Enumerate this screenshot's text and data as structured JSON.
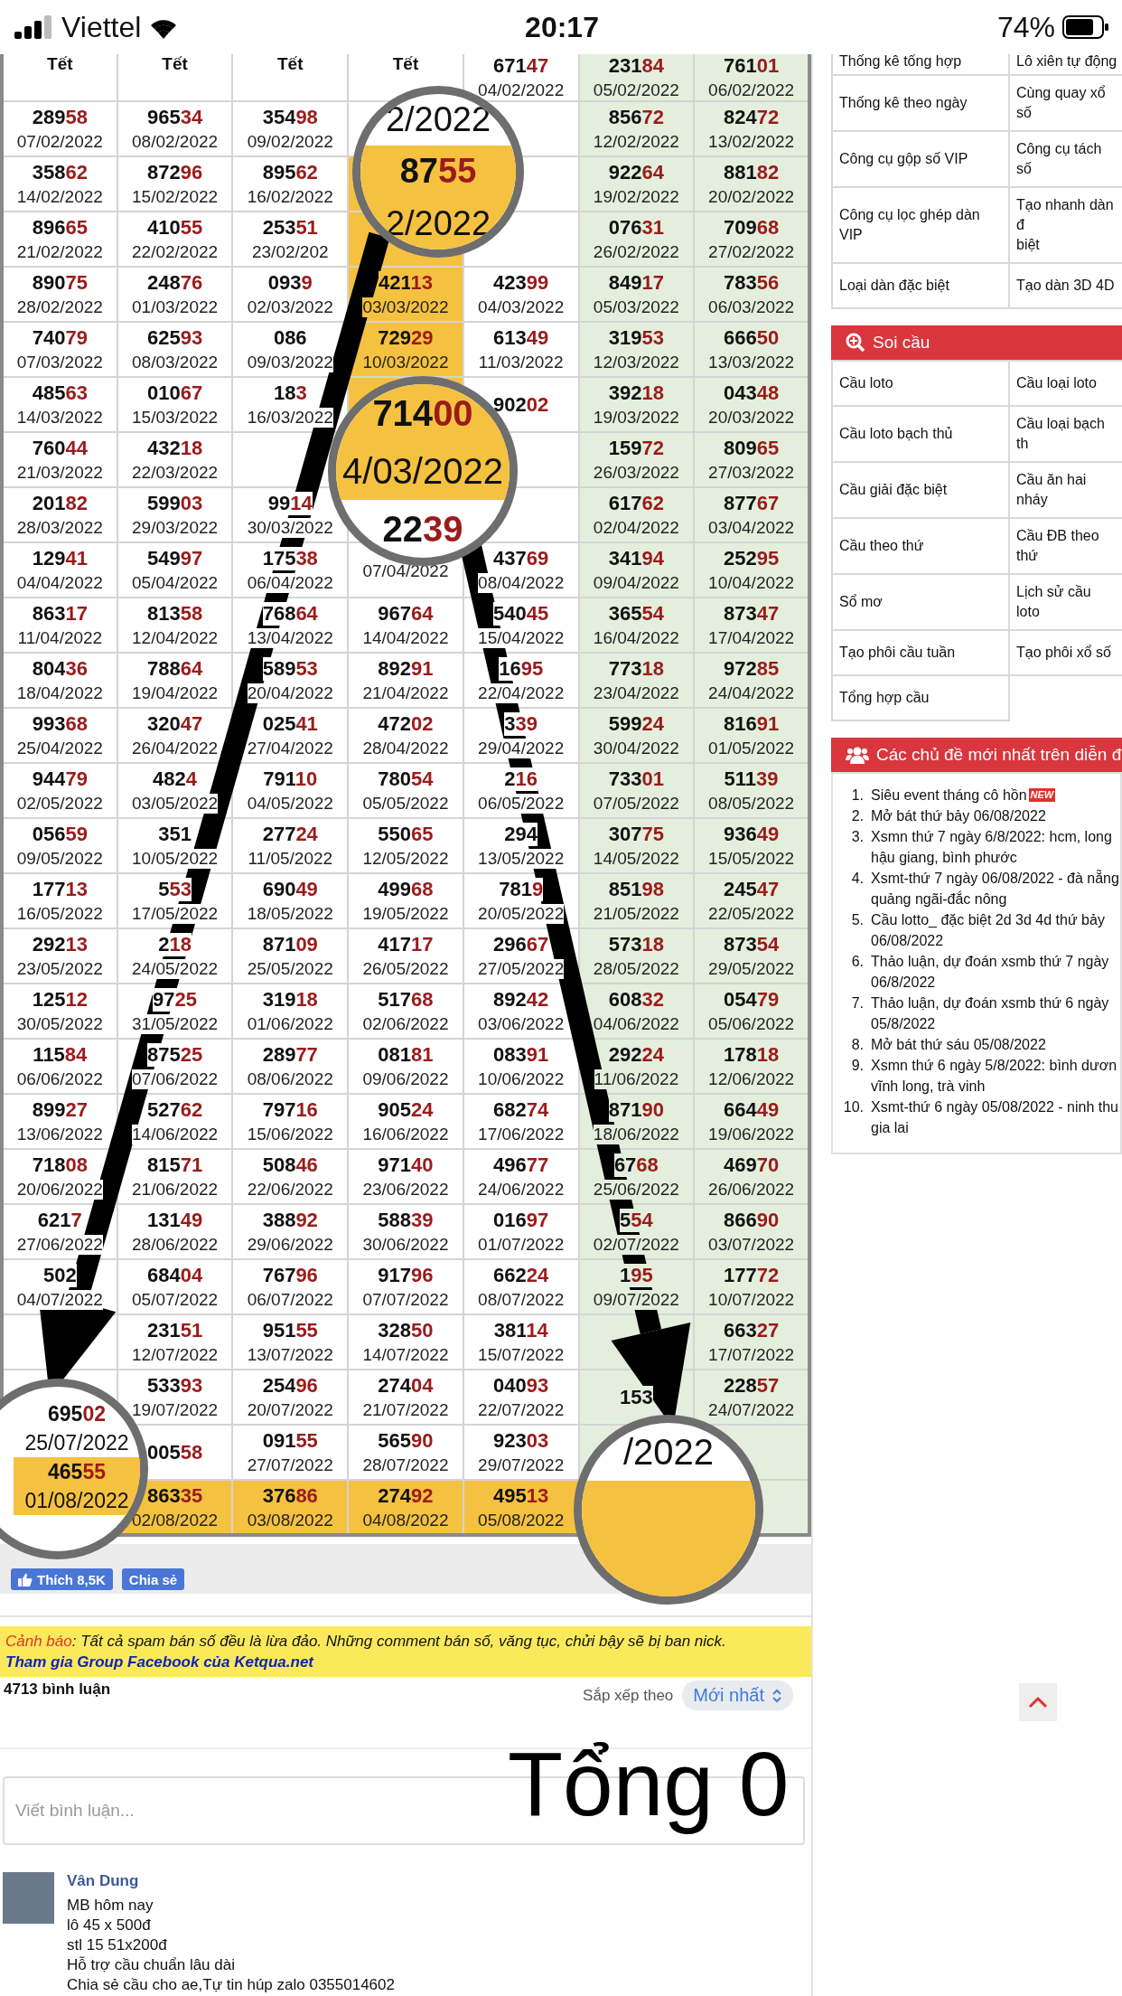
{
  "status_bar": {
    "carrier": "Viettel",
    "time": "20:17",
    "battery": "74%"
  },
  "weekend_columns": [
    false,
    false,
    false,
    false,
    false,
    true,
    true
  ],
  "rows": [
    [
      {
        "label": "Tết",
        "highlighted": false
      },
      {
        "label": "Tết",
        "highlighted": false
      },
      {
        "label": "Tết",
        "highlighted": false
      },
      {
        "label": "Tết",
        "highlighted": false
      },
      {
        "num": "671",
        "end": "47",
        "date": "04/02/2022",
        "highlighted": false
      },
      {
        "num": "231",
        "end": "84",
        "date": "05/02/2022",
        "highlighted": false
      },
      {
        "num": "761",
        "end": "01",
        "date": "06/02/2022",
        "highlighted": false
      }
    ],
    [
      {
        "num": "289",
        "end": "58",
        "date": "07/02/2022",
        "highlighted": false
      },
      {
        "num": "965",
        "end": "34",
        "date": "08/02/2022",
        "highlighted": false
      },
      {
        "num": "354",
        "end": "98",
        "date": "09/02/2022",
        "highlighted": false
      },
      {
        "highlighted": false
      },
      {
        "highlighted": false
      },
      {
        "num": "856",
        "end": "72",
        "date": "12/02/2022",
        "highlighted": false
      },
      {
        "num": "824",
        "end": "72",
        "date": "13/02/2022",
        "highlighted": false
      }
    ],
    [
      {
        "num": "358",
        "end": "62",
        "date": "14/02/2022",
        "highlighted": false
      },
      {
        "num": "872",
        "end": "96",
        "date": "15/02/2022",
        "highlighted": false
      },
      {
        "num": "895",
        "end": "62",
        "date": "16/02/2022",
        "highlighted": false
      },
      {
        "highlighted": true
      },
      {
        "highlighted": false
      },
      {
        "num": "922",
        "end": "64",
        "date": "19/02/2022",
        "highlighted": false
      },
      {
        "num": "881",
        "end": "82",
        "date": "20/02/2022",
        "highlighted": false
      }
    ],
    [
      {
        "num": "896",
        "end": "65",
        "date": "21/02/2022",
        "highlighted": false
      },
      {
        "num": "410",
        "end": "55",
        "date": "22/02/2022",
        "highlighted": false
      },
      {
        "num": "253",
        "end": "51",
        "date": "23/02/202",
        "highlighted": false
      },
      {
        "highlighted": true
      },
      {
        "highlighted": false
      },
      {
        "num": "076",
        "end": "31",
        "date": "26/02/2022",
        "highlighted": false
      },
      {
        "num": "709",
        "end": "68",
        "date": "27/02/2022",
        "highlighted": false
      }
    ],
    [
      {
        "num": "890",
        "end": "75",
        "date": "28/02/2022",
        "highlighted": false
      },
      {
        "num": "248",
        "end": "76",
        "date": "01/03/2022",
        "highlighted": false
      },
      {
        "num": "093",
        "end": "9",
        "date": "02/03/2022",
        "highlighted": false
      },
      {
        "num": "421",
        "end": "13",
        "date": "03/03/2022",
        "highlighted": true
      },
      {
        "num": "423",
        "end": "99",
        "date": "04/03/2022",
        "highlighted": false
      },
      {
        "num": "849",
        "end": "17",
        "date": "05/03/2022",
        "highlighted": false
      },
      {
        "num": "783",
        "end": "56",
        "date": "06/03/2022",
        "highlighted": false
      }
    ],
    [
      {
        "num": "740",
        "end": "79",
        "date": "07/03/2022",
        "highlighted": false
      },
      {
        "num": "625",
        "end": "93",
        "date": "08/03/2022",
        "highlighted": false
      },
      {
        "num": "086",
        "date": "09/03/2022",
        "highlighted": false
      },
      {
        "num": "729",
        "end": "29",
        "date": "10/03/2022",
        "highlighted": true
      },
      {
        "num": "613",
        "end": "49",
        "date": "11/03/2022",
        "highlighted": false
      },
      {
        "num": "319",
        "end": "53",
        "date": "12/03/2022",
        "highlighted": false
      },
      {
        "num": "666",
        "end": "50",
        "date": "13/03/2022",
        "highlighted": false
      }
    ],
    [
      {
        "num": "485",
        "end": "63",
        "date": "14/03/2022",
        "highlighted": false
      },
      {
        "num": "010",
        "end": "67",
        "date": "15/03/2022",
        "highlighted": false
      },
      {
        "num": "18",
        "end": "3",
        "date": "16/03/2022",
        "highlighted": false
      },
      {
        "highlighted": true
      },
      {
        "num": "902",
        "end": "02",
        "highlighted": false
      },
      {
        "num": "392",
        "end": "18",
        "date": "19/03/2022",
        "highlighted": false
      },
      {
        "num": "043",
        "end": "48",
        "date": "20/03/2022",
        "highlighted": false
      }
    ],
    [
      {
        "num": "760",
        "end": "44",
        "date": "21/03/2022",
        "highlighted": false
      },
      {
        "num": "432",
        "end": "18",
        "date": "22/03/2022",
        "highlighted": false
      },
      {
        "highlighted": false
      },
      {},
      {
        "highlighted": false
      },
      {
        "num": "159",
        "end": "72",
        "date": "26/03/2022",
        "highlighted": false
      },
      {
        "num": "809",
        "end": "65",
        "date": "27/03/2022",
        "highlighted": false
      }
    ],
    [
      {
        "num": "201",
        "end": "82",
        "date": "28/03/2022",
        "highlighted": false
      },
      {
        "num": "599",
        "end": "03",
        "date": "29/03/2022",
        "highlighted": false
      },
      {
        "num": "99",
        "end": "14",
        "date": "30/03/2022",
        "highlighted": false
      },
      {
        "highlighted": false
      },
      {
        "highlighted": false
      },
      {
        "num": "617",
        "end": "62",
        "date": "02/04/2022",
        "highlighted": false
      },
      {
        "num": "877",
        "end": "67",
        "date": "03/04/2022",
        "highlighted": false
      }
    ],
    [
      {
        "num": "129",
        "end": "41",
        "date": "04/04/2022",
        "highlighted": false
      },
      {
        "num": "549",
        "end": "97",
        "date": "05/04/2022",
        "highlighted": false
      },
      {
        "num": "175",
        "end": "38",
        "date": "06/04/2022",
        "highlighted": false
      },
      {
        "date": "07/04/2022",
        "highlighted": false
      },
      {
        "num": "437",
        "end": "69",
        "date": "08/04/2022",
        "highlighted": false
      },
      {
        "num": "341",
        "end": "94",
        "date": "09/04/2022",
        "highlighted": false
      },
      {
        "num": "252",
        "end": "95",
        "date": "10/04/2022",
        "highlighted": false
      }
    ],
    [
      {
        "num": "863",
        "end": "17",
        "date": "11/04/2022",
        "highlighted": false
      },
      {
        "num": "813",
        "end": "58",
        "date": "12/04/2022",
        "highlighted": false
      },
      {
        "num": "768",
        "end": "64",
        "date": "13/04/2022",
        "highlighted": false
      },
      {
        "num": "967",
        "end": "64",
        "date": "14/04/2022",
        "highlighted": false
      },
      {
        "num": "540",
        "end": "45",
        "date": "15/04/2022",
        "highlighted": false
      },
      {
        "num": "365",
        "end": "54",
        "date": "16/04/2022",
        "highlighted": false
      },
      {
        "num": "873",
        "end": "47",
        "date": "17/04/2022",
        "highlighted": false
      }
    ],
    [
      {
        "num": "804",
        "end": "36",
        "date": "18/04/2022",
        "highlighted": false
      },
      {
        "num": "788",
        "end": "64",
        "date": "19/04/2022",
        "highlighted": false
      },
      {
        "num": "589",
        "end": "53",
        "date": "20/04/2022",
        "highlighted": false
      },
      {
        "num": "892",
        "end": "91",
        "date": "21/04/2022",
        "highlighted": false
      },
      {
        "num": "16",
        "end": "95",
        "date": "22/04/2022",
        "highlighted": false
      },
      {
        "num": "773",
        "end": "18",
        "date": "23/04/2022",
        "highlighted": false
      },
      {
        "num": "972",
        "end": "85",
        "date": "24/04/2022",
        "highlighted": false
      }
    ],
    [
      {
        "num": "993",
        "end": "68",
        "date": "25/04/2022",
        "highlighted": false
      },
      {
        "num": "320",
        "end": "47",
        "date": "26/04/2022",
        "highlighted": false
      },
      {
        "num": "025",
        "end": "41",
        "date": "27/04/2022",
        "highlighted": false
      },
      {
        "num": "472",
        "end": "02",
        "date": "28/04/2022",
        "highlighted": false
      },
      {
        "num": "3",
        "end": "39",
        "date": "29/04/2022",
        "highlighted": false
      },
      {
        "num": "599",
        "end": "24",
        "date": "30/04/2022",
        "highlighted": false
      },
      {
        "num": "816",
        "end": "91",
        "date": "01/05/2022",
        "highlighted": false
      }
    ],
    [
      {
        "num": "944",
        "end": "79",
        "date": "02/05/2022",
        "highlighted": false
      },
      {
        "num": "482",
        "end": "4",
        "date": "03/05/2022",
        "highlighted": false
      },
      {
        "num": "791",
        "end": "10",
        "date": "04/05/2022",
        "highlighted": false
      },
      {
        "num": "780",
        "end": "54",
        "date": "05/05/2022",
        "highlighted": false
      },
      {
        "num": "2",
        "end": "16",
        "date": "06/05/2022",
        "highlighted": false
      },
      {
        "num": "733",
        "end": "01",
        "date": "07/05/2022",
        "highlighted": false
      },
      {
        "num": "511",
        "end": "39",
        "date": "08/05/2022",
        "highlighted": false
      }
    ],
    [
      {
        "num": "056",
        "end": "59",
        "date": "09/05/2022",
        "highlighted": false
      },
      {
        "num": "351",
        "date": "10/05/2022",
        "highlighted": false
      },
      {
        "num": "277",
        "end": "24",
        "date": "11/05/2022",
        "highlighted": false
      },
      {
        "num": "550",
        "end": "65",
        "date": "12/05/2022",
        "highlighted": false
      },
      {
        "num": "294",
        "date": "13/05/2022",
        "highlighted": false
      },
      {
        "num": "307",
        "end": "75",
        "date": "14/05/2022",
        "highlighted": false
      },
      {
        "num": "936",
        "end": "49",
        "date": "15/05/2022",
        "highlighted": false
      }
    ],
    [
      {
        "num": "177",
        "end": "13",
        "date": "16/05/2022",
        "highlighted": false
      },
      {
        "num": "5",
        "end": "53",
        "date": "17/05/2022",
        "highlighted": false
      },
      {
        "num": "690",
        "end": "49",
        "date": "18/05/2022",
        "highlighted": false
      },
      {
        "num": "499",
        "end": "68",
        "date": "19/05/2022",
        "highlighted": false
      },
      {
        "num": "781",
        "end": "9",
        "date": "20/05/2022",
        "highlighted": false
      },
      {
        "num": "851",
        "end": "98",
        "date": "21/05/2022",
        "highlighted": false
      },
      {
        "num": "245",
        "end": "47",
        "date": "22/05/2022",
        "highlighted": false
      }
    ],
    [
      {
        "num": "292",
        "end": "13",
        "date": "23/05/2022",
        "highlighted": false
      },
      {
        "num": "2",
        "end": "18",
        "date": "24/05/2022",
        "highlighted": false
      },
      {
        "num": "871",
        "end": "09",
        "date": "25/05/2022",
        "highlighted": false
      },
      {
        "num": "417",
        "end": "17",
        "date": "26/05/2022",
        "highlighted": false
      },
      {
        "num": "296",
        "end": "67",
        "date": "27/05/2022",
        "highlighted": false
      },
      {
        "num": "573",
        "end": "18",
        "date": "28/05/2022",
        "highlighted": false
      },
      {
        "num": "873",
        "end": "54",
        "date": "29/05/2022",
        "highlighted": false
      }
    ],
    [
      {
        "num": "125",
        "end": "12",
        "date": "30/05/2022",
        "highlighted": false
      },
      {
        "num": "97",
        "end": "25",
        "date": "31/05/2022",
        "highlighted": false
      },
      {
        "num": "319",
        "end": "18",
        "date": "01/06/2022",
        "highlighted": false
      },
      {
        "num": "517",
        "end": "68",
        "date": "02/06/2022",
        "highlighted": false
      },
      {
        "num": "892",
        "end": "42",
        "date": "03/06/2022",
        "highlighted": false
      },
      {
        "num": "608",
        "end": "32",
        "date": "04/06/2022",
        "highlighted": false
      },
      {
        "num": "054",
        "end": "79",
        "date": "05/06/2022",
        "highlighted": false
      }
    ],
    [
      {
        "num": "115",
        "end": "84",
        "date": "06/06/2022",
        "highlighted": false
      },
      {
        "num": "875",
        "end": "25",
        "date": "07/06/2022",
        "highlighted": false
      },
      {
        "num": "289",
        "end": "77",
        "date": "08/06/2022",
        "highlighted": false
      },
      {
        "num": "081",
        "end": "81",
        "date": "09/06/2022",
        "highlighted": false
      },
      {
        "num": "083",
        "end": "91",
        "date": "10/06/2022",
        "highlighted": false
      },
      {
        "num": "292",
        "end": "24",
        "date": "11/06/2022",
        "highlighted": false
      },
      {
        "num": "178",
        "end": "18",
        "date": "12/06/2022",
        "highlighted": false
      }
    ],
    [
      {
        "num": "899",
        "end": "27",
        "date": "13/06/2022",
        "highlighted": false
      },
      {
        "num": "527",
        "end": "62",
        "date": "14/06/2022",
        "highlighted": false
      },
      {
        "num": "797",
        "end": "16",
        "date": "15/06/2022",
        "highlighted": false
      },
      {
        "num": "905",
        "end": "24",
        "date": "16/06/2022",
        "highlighted": false
      },
      {
        "num": "682",
        "end": "74",
        "date": "17/06/2022",
        "highlighted": false
      },
      {
        "num": "871",
        "end": "90",
        "date": "18/06/2022",
        "highlighted": false
      },
      {
        "num": "664",
        "end": "49",
        "date": "19/06/2022",
        "highlighted": false
      }
    ],
    [
      {
        "num": "718",
        "end": "08",
        "date": "20/06/2022",
        "highlighted": false
      },
      {
        "num": "815",
        "end": "71",
        "date": "21/06/2022",
        "highlighted": false
      },
      {
        "num": "508",
        "end": "46",
        "date": "22/06/2022",
        "highlighted": false
      },
      {
        "num": "971",
        "end": "40",
        "date": "23/06/2022",
        "highlighted": false
      },
      {
        "num": "496",
        "end": "77",
        "date": "24/06/2022",
        "highlighted": false
      },
      {
        "num": "67",
        "end": "68",
        "date": "25/06/2022",
        "highlighted": false
      },
      {
        "num": "469",
        "end": "70",
        "date": "26/06/2022",
        "highlighted": false
      }
    ],
    [
      {
        "num": "621",
        "end": "7",
        "date": "27/06/2022",
        "highlighted": false
      },
      {
        "num": "131",
        "end": "49",
        "date": "28/06/2022",
        "highlighted": false
      },
      {
        "num": "388",
        "end": "92",
        "date": "29/06/2022",
        "highlighted": false
      },
      {
        "num": "588",
        "end": "39",
        "date": "30/06/2022",
        "highlighted": false
      },
      {
        "num": "016",
        "end": "97",
        "date": "01/07/2022",
        "highlighted": false
      },
      {
        "num": "5",
        "end": "54",
        "date": "02/07/2022",
        "highlighted": false
      },
      {
        "num": "866",
        "end": "90",
        "date": "03/07/2022",
        "highlighted": false
      }
    ],
    [
      {
        "num": "502",
        "date": "04/07/2022",
        "highlighted": false
      },
      {
        "num": "684",
        "end": "04",
        "date": "05/07/2022",
        "highlighted": false
      },
      {
        "num": "767",
        "end": "96",
        "date": "06/07/2022",
        "highlighted": false
      },
      {
        "num": "917",
        "end": "96",
        "date": "07/07/2022",
        "highlighted": false
      },
      {
        "num": "662",
        "end": "24",
        "date": "08/07/2022",
        "highlighted": false
      },
      {
        "num": "1",
        "end": "95",
        "date": "09/07/2022",
        "highlighted": false
      },
      {
        "num": "177",
        "end": "72",
        "date": "10/07/2022",
        "highlighted": false
      }
    ],
    [
      {
        "highlighted": false
      },
      {
        "num": "231",
        "end": "51",
        "date": "12/07/2022",
        "highlighted": false
      },
      {
        "num": "951",
        "end": "55",
        "date": "13/07/2022",
        "highlighted": false
      },
      {
        "num": "328",
        "end": "50",
        "date": "14/07/2022",
        "highlighted": false
      },
      {
        "num": "381",
        "end": "14",
        "date": "15/07/2022",
        "highlighted": false
      },
      {
        "highlighted": false
      },
      {
        "num": "663",
        "end": "27",
        "date": "17/07/2022",
        "highlighted": false
      }
    ],
    [
      {
        "highlighted": false
      },
      {
        "num": "533",
        "end": "93",
        "date": "19/07/2022",
        "highlighted": false
      },
      {
        "num": "254",
        "end": "96",
        "date": "20/07/2022",
        "highlighted": false
      },
      {
        "num": "274",
        "end": "04",
        "date": "21/07/2022",
        "highlighted": false
      },
      {
        "num": "040",
        "end": "93",
        "date": "22/07/2022",
        "highlighted": false
      },
      {
        "num": "153",
        "highlighted": false
      },
      {
        "num": "228",
        "end": "57",
        "date": "24/07/2022",
        "highlighted": false
      }
    ],
    [
      {},
      {
        "num": "005",
        "end": "58",
        "highlighted": false
      },
      {
        "num": "091",
        "end": "55",
        "date": "27/07/2022",
        "highlighted": false
      },
      {
        "num": "565",
        "end": "90",
        "date": "28/07/2022",
        "highlighted": false
      },
      {
        "num": "923",
        "end": "03",
        "date": "29/07/2022",
        "highlighted": false
      },
      {},
      {
        "highlighted": false
      }
    ],
    [
      {},
      {
        "num": "863",
        "end": "35",
        "date": "02/08/2022",
        "highlighted": true
      },
      {
        "num": "376",
        "end": "86",
        "date": "03/08/2022",
        "highlighted": true
      },
      {
        "num": "274",
        "end": "92",
        "date": "04/08/2022",
        "highlighted": true
      },
      {
        "num": "495",
        "end": "13",
        "date": "05/08/2022",
        "highlighted": true
      },
      {},
      {
        "highlighted": false
      }
    ]
  ],
  "magnifiers": [
    {
      "lines": [
        {
          "text": "2/2022",
          "highlighted": false
        },
        {
          "num": "87",
          "end": "55",
          "highlighted": true
        },
        {
          "text": "2/2022",
          "highlighted": true
        }
      ]
    },
    {
      "lines": [
        {
          "num": "714",
          "end": "00",
          "highlighted": true
        },
        {
          "text": "4/03/2022",
          "highlighted": true
        },
        {
          "num": "22",
          "end": "39",
          "highlighted": false
        }
      ]
    },
    {
      "lines": [
        {
          "num": "695",
          "end": "02",
          "highlighted": false
        },
        {
          "text": "25/07/2022",
          "highlighted": false
        },
        {
          "num": "465",
          "end": "55",
          "highlighted": true
        },
        {
          "text": "01/08/2022",
          "highlighted": true
        }
      ]
    },
    {
      "lines": [
        {
          "text": "/2022",
          "highlighted": false
        },
        {
          "highlighted": true
        },
        {
          "highlighted": true
        }
      ]
    }
  ],
  "social": {
    "like": "Thích 8,5K",
    "share": "Chia sẻ"
  },
  "sidebar": {
    "tools": [
      [
        "Thống kê tổng hợp",
        "Lô xiên tự động"
      ],
      [
        "Thống kê theo ngày",
        "Cùng quay xổ số"
      ],
      [
        "Công cụ gộp số VIP",
        "Công cụ tách số"
      ],
      [
        "Công cụ lọc ghép dàn\nVIP",
        "Tạo nhanh dàn đ\nbiệt"
      ],
      [
        "Loại dàn đặc biệt",
        "Tạo dàn 3D 4D"
      ]
    ],
    "soi_cau": {
      "title": "Soi cầu",
      "links": [
        [
          "Cầu loto",
          "Cầu loại loto"
        ],
        [
          "Cầu loto bạch thủ",
          "Cầu loại bạch th"
        ],
        [
          "Cầu giải đặc biệt",
          "Cầu ăn hai nháy"
        ],
        [
          "Cầu theo thứ",
          "Cầu ĐB theo thứ"
        ],
        [
          "Sổ mơ",
          "Lịch sử cầu loto"
        ],
        [
          "Tạo phôi cầu tuần",
          "Tạo phôi xổ số"
        ],
        [
          "Tổng hợp cầu"
        ]
      ]
    },
    "topics": {
      "title": "Các chủ đề mới nhất trên diễn đ",
      "items": [
        {
          "number": "1.",
          "text": "Siêu event tháng cô hồn",
          "badge": "NEW"
        },
        {
          "number": "2.",
          "text": "Mở bát thứ bảy 06/08/2022"
        },
        {
          "number": "3.",
          "text": "Xsmn thứ 7 ngày 6/8/2022: hcm, long\nhậu giang, bình phước"
        },
        {
          "number": "4.",
          "text": "Xsmt-thứ 7 ngày 06/08/2022 - đà nẵng\nquảng ngãi-đắc nông"
        },
        {
          "number": "5.",
          "text": "Cầu lotto_ đặc biệt 2d 3d 4d thứ bảy\n06/08/2022"
        },
        {
          "number": "6.",
          "text": "Thảo luận, dự đoán xsmb thứ 7 ngày\n06/8/2022"
        },
        {
          "number": "7.",
          "text": "Thảo luận, dự đoán xsmb thứ 6 ngày\n05/8/2022"
        },
        {
          "number": "8.",
          "text": "Mở bát thứ sáu 05/08/2022"
        },
        {
          "number": "9.",
          "text": "Xsmn thứ 6 ngày 5/8/2022: bình dươn\nvĩnh long, trà vinh"
        },
        {
          "number": "10.",
          "text": "Xsmt-thứ 6 ngày 05/08/2022 - ninh thu\ngia lai"
        }
      ]
    }
  },
  "warning": {
    "label": "Cảnh báo",
    "text": ": Tất cả spam bán số đều là lừa đảo. Những comment bán số, văng tục, chửi bậy sẽ bị ban nick.",
    "link": "Tham gia Group Facebook của Ketqua.net"
  },
  "comments": {
    "count": "4713 bình luận",
    "sort_label": "Sắp xếp theo",
    "sort_value": "Mới nhất",
    "placeholder": "Viết bình luận...",
    "items": [
      {
        "author": "Vân Dung",
        "text": "MB hôm nay\nlô 45 x 500đ\nstl 15 51x200đ\nHỗ trợ cầu chuẩn lâu dài\nChia sẻ cầu cho ae,Tự tin húp zalo 0355014602"
      }
    ]
  },
  "overlay_caption": "Tổng 0"
}
